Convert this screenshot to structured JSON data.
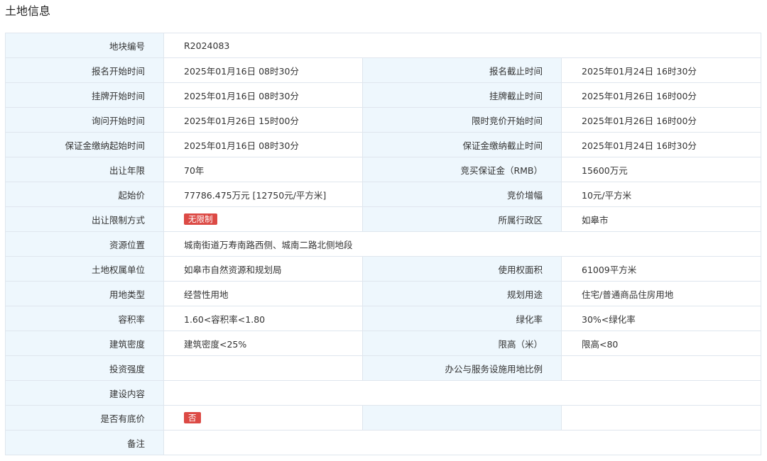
{
  "title": "土地信息",
  "rows": {
    "plot_no": {
      "label": "地块编号",
      "value": "R2024083"
    },
    "reg_start": {
      "label": "报名开始时间",
      "value": "2025年01月16日 08时30分"
    },
    "reg_end": {
      "label": "报名截止时间",
      "value": "2025年01月24日 16时30分"
    },
    "list_start": {
      "label": "挂牌开始时间",
      "value": "2025年01月16日 08时30分"
    },
    "list_end": {
      "label": "挂牌截止时间",
      "value": "2025年01月26日 16时00分"
    },
    "inquiry_start": {
      "label": "询问开始时间",
      "value": "2025年01月26日 15时00分"
    },
    "timed_bid_start": {
      "label": "限时竞价开始时间",
      "value": "2025年01月26日 16时00分"
    },
    "deposit_start": {
      "label": "保证金缴纳起始时间",
      "value": "2025年01月16日 08时30分"
    },
    "deposit_end": {
      "label": "保证金缴纳截止时间",
      "value": "2025年01月24日 16时30分"
    },
    "term": {
      "label": "出让年限",
      "value": "70年"
    },
    "bid_deposit": {
      "label": "竞买保证金（RMB）",
      "value": "15600万元"
    },
    "start_price": {
      "label": "起始价",
      "value": "77786.475万元 [12750元/平方米]"
    },
    "increment": {
      "label": "竞价增幅",
      "value": "10元/平方米"
    },
    "restriction": {
      "label": "出让限制方式",
      "value": "无限制"
    },
    "district": {
      "label": "所属行政区",
      "value": "如皋市"
    },
    "location": {
      "label": "资源位置",
      "value": "城南街道万寿南路西侧、城南二路北侧地段"
    },
    "owner": {
      "label": "土地权属单位",
      "value": "如皋市自然资源和规划局"
    },
    "area": {
      "label": "使用权面积",
      "value": "61009平方米"
    },
    "land_type": {
      "label": "用地类型",
      "value": "经营性用地"
    },
    "planned_use": {
      "label": "规划用途",
      "value": "住宅/普通商品住房用地"
    },
    "far": {
      "label": "容积率",
      "value": "1.60<容积率<1.80"
    },
    "green_rate": {
      "label": "绿化率",
      "value": "30%<绿化率"
    },
    "density": {
      "label": "建筑密度",
      "value": "建筑密度<25%"
    },
    "height": {
      "label": "限高（米）",
      "value": "限高<80"
    },
    "investment": {
      "label": "投资强度",
      "value": ""
    },
    "office_ratio": {
      "label": "办公与服务设施用地比例",
      "value": ""
    },
    "construction": {
      "label": "建设内容",
      "value": ""
    },
    "reserve_price": {
      "label": "是否有底价",
      "value": "否"
    },
    "remarks": {
      "label": "备注",
      "value": ""
    }
  },
  "colors": {
    "label_bg": "#eef7fd",
    "border": "#dfe6ee",
    "badge": "#dc4a45"
  }
}
